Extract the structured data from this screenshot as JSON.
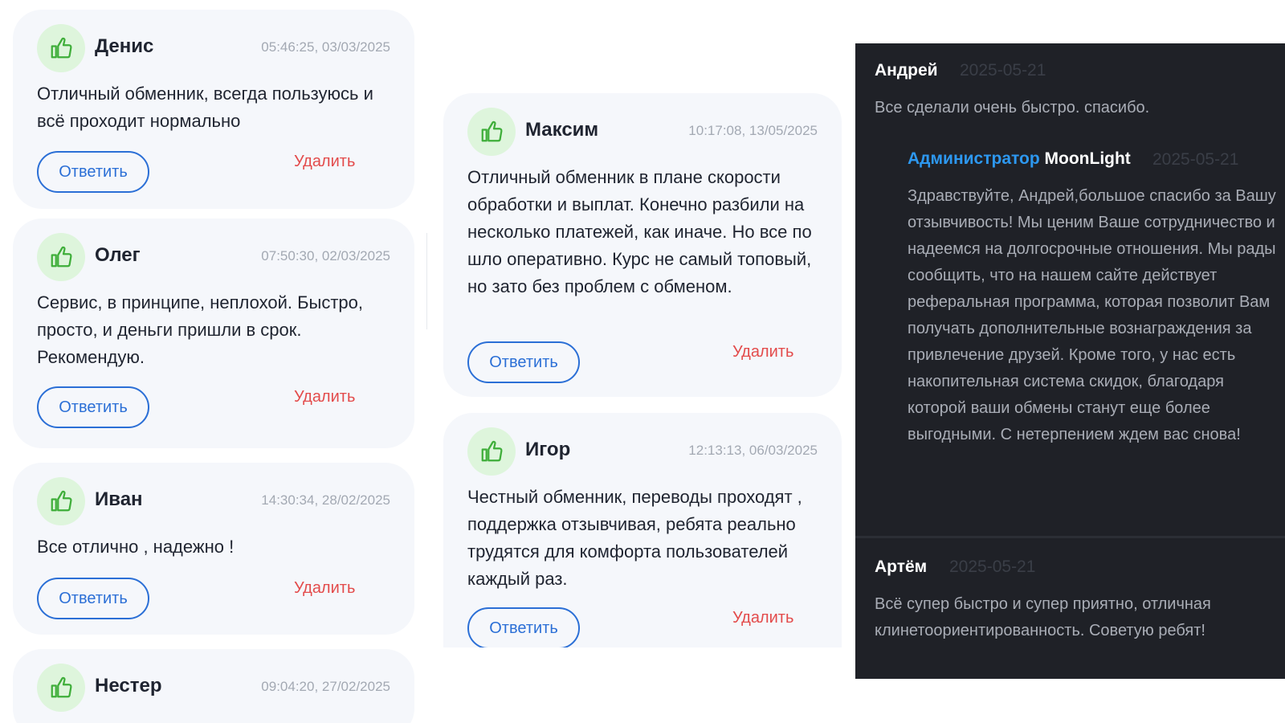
{
  "common": {
    "reply_label": "Ответить",
    "delete_label": "Удалить",
    "colors": {
      "avatar_bg": "#def5dc",
      "like_icon": "#3fae3a",
      "reply_accent": "#2b6fd6",
      "delete_accent": "#e34b4b",
      "card_bg": "#f5f7fb",
      "dark_panel_bg": "#1f2127",
      "admin_accent": "#2d98f0"
    },
    "avatar_icon": "thumbs-up-icon"
  },
  "left_column": [
    {
      "author": "Денис",
      "timestamp": "05:46:25, 03/03/2025",
      "text": "Отличный обменник, всегда пользуюсь и всё проходит нормально"
    },
    {
      "author": "Олег",
      "timestamp": "07:50:30, 02/03/2025",
      "text": "Сервис, в принципе, неплохой. Быстро, просто, и деньги пришли в срок. Рекомендую."
    },
    {
      "author": "Иван",
      "timestamp": "14:30:34, 28/02/2025",
      "text": "Все отлично , надежно !"
    },
    {
      "author": "Нестер",
      "timestamp": "09:04:20, 27/02/2025"
    }
  ],
  "middle_column": [
    {
      "author": "Максим",
      "timestamp": "10:17:08, 13/05/2025",
      "text": "Отличный обменник в плане скорости обработки и выплат. Конечно разбили на несколько платежей, как иначе. Но все по шло оперативно. Курс не самый топовый, но зато без проблем с обменом."
    },
    {
      "author": "Игор",
      "timestamp": "12:13:13, 06/03/2025",
      "text": "Честный обменник, переводы проходят , поддержка отзывчивая, ребята реально трудятся для комфорта пользователей каждый раз."
    }
  ],
  "dark_panel": {
    "review1": {
      "author": "Андрей",
      "date": "2025-05-21",
      "text": "Все сделали очень быстро. спасибо."
    },
    "admin_reply": {
      "role": "Администратор",
      "name": "MoonLight",
      "date": "2025-05-21",
      "text": "Здравствуйте, Андрей,большое спасибо за Вашу отзывчивость! Мы ценим Ваше сотрудничество и надеемся на долгосрочные отношения. Мы рады сообщить, что на нашем сайте действует реферальная программа, которая позволит Вам получать дополнительные вознаграждения за привлечение друзей. Кроме того, у нас есть накопительная система скидок, благодаря которой ваши обмены станут еще более выгодными. С нетерпением ждем вас снова!"
    },
    "review2": {
      "author": "Артём",
      "date": "2025-05-21",
      "text": "Всё супер быстро и супер приятно, отличная клинетоориентированность. Советую ребят!"
    }
  }
}
